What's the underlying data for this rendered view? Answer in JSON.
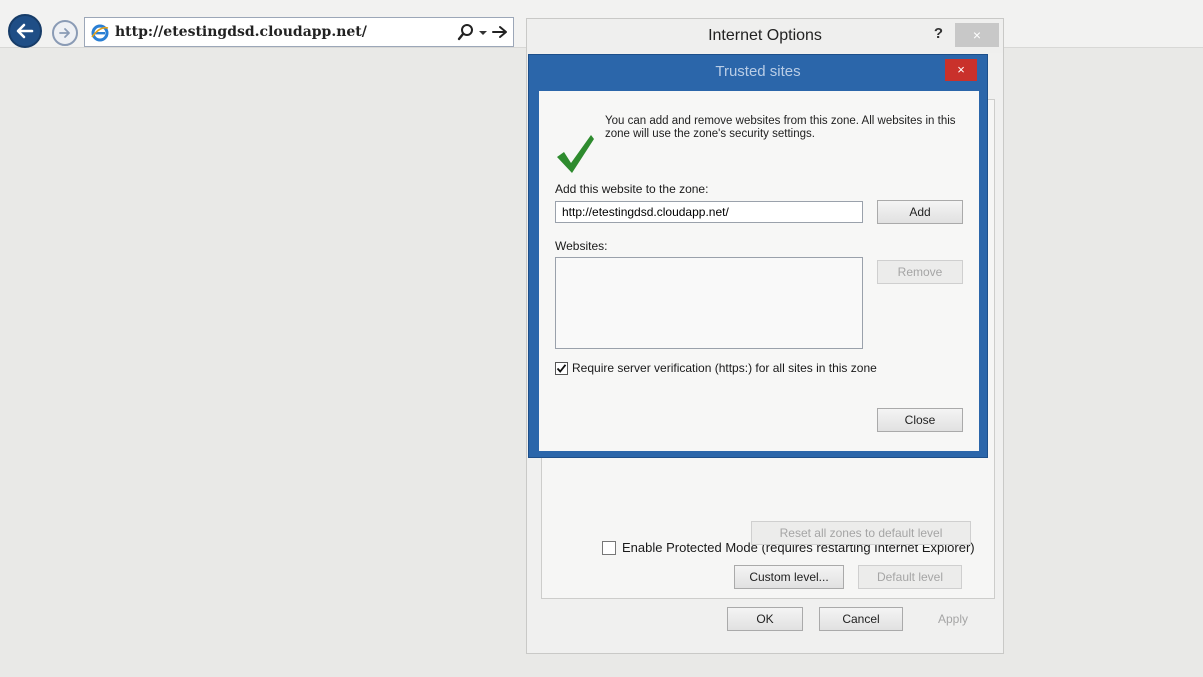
{
  "browser": {
    "url": "http://etestingdsd.cloudapp.net/"
  },
  "internet_options": {
    "title": "Internet Options",
    "help_label": "?",
    "close_label": "×",
    "protected_mode_label": "Enable Protected Mode (requires restarting Internet Explorer)",
    "custom_level_label": "Custom level...",
    "default_level_label": "Default level",
    "reset_zones_label": "Reset all zones to default level",
    "ok_label": "OK",
    "cancel_label": "Cancel",
    "apply_label": "Apply"
  },
  "trusted_sites": {
    "title": "Trusted sites",
    "close_label": "×",
    "info_text": "You can add and remove websites from this zone. All websites in this zone will use the zone's security settings.",
    "add_label": "Add this website to the zone:",
    "add_value": "http://etestingdsd.cloudapp.net/",
    "add_button": "Add",
    "websites_label": "Websites:",
    "remove_button": "Remove",
    "require_label": "Require server verification (https:) for all sites in this zone",
    "require_checked": true,
    "close_button": "Close"
  },
  "colors": {
    "trusted_sites_frame": "#2b66aa",
    "close_red": "#c9312b",
    "check_green": "#2e8b2e",
    "back_button": "#1f4e86"
  }
}
